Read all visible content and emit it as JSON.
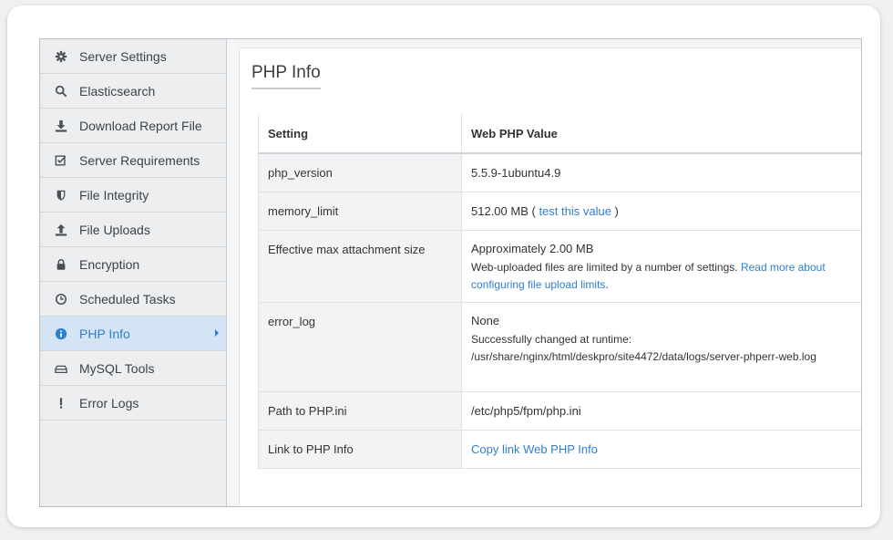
{
  "sidebar": {
    "items": [
      {
        "label": "Server Settings",
        "icon": "gear-icon"
      },
      {
        "label": "Elasticsearch",
        "icon": "search-icon"
      },
      {
        "label": "Download Report File",
        "icon": "download-icon"
      },
      {
        "label": "Server Requirements",
        "icon": "checkbox-icon"
      },
      {
        "label": "File Integrity",
        "icon": "shield-icon"
      },
      {
        "label": "File Uploads",
        "icon": "upload-icon"
      },
      {
        "label": "Encryption",
        "icon": "lock-icon"
      },
      {
        "label": "Scheduled Tasks",
        "icon": "clock-icon"
      },
      {
        "label": "PHP Info",
        "icon": "info-icon",
        "active": true
      },
      {
        "label": "MySQL Tools",
        "icon": "database-icon"
      },
      {
        "label": "Error Logs",
        "icon": "exclamation-icon"
      }
    ]
  },
  "main": {
    "title": "PHP Info",
    "table": {
      "headers": {
        "setting": "Setting",
        "value": "Web PHP Value"
      },
      "rows": [
        {
          "setting": "php_version",
          "value": "5.5.9-1ubuntu4.9"
        },
        {
          "setting": "memory_limit",
          "value_prefix": "512.00 MB ( ",
          "value_link": "test this value",
          "value_suffix": " )"
        },
        {
          "setting": "Effective max attachment size",
          "value": "Approximately 2.00 MB",
          "note": "Web-uploaded files are limited by a number of settings. ",
          "note_link": "Read more about configuring file upload limits",
          "note_suffix": "."
        },
        {
          "setting": "error_log",
          "value": "None",
          "note": "Successfully changed at runtime: /usr/share/nginx/html/deskpro/site4472/data/logs/server-phperr-web.log"
        },
        {
          "setting": "Path to PHP.ini",
          "value": "/etc/php5/fpm/php.ini"
        },
        {
          "setting": "Link to PHP Info",
          "value_link": "Copy link Web PHP Info"
        }
      ]
    }
  },
  "colors": {
    "accent": "#2f7fcf",
    "active_bg": "#d4e4f4",
    "sidebar_bg": "#eceeef"
  }
}
